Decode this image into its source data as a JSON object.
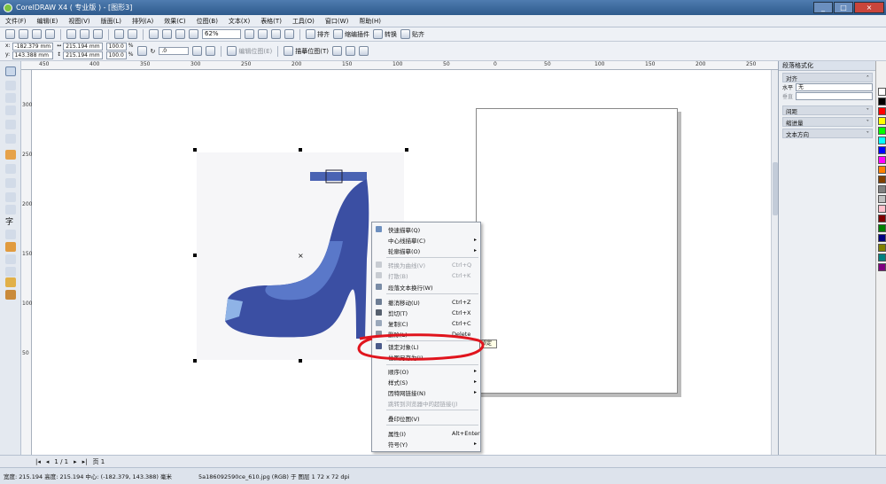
{
  "window": {
    "title": "CorelDRAW X4 ( 专业版 ) - [图形3]",
    "buttons": [
      "_",
      "□",
      "×"
    ]
  },
  "menubar": {
    "items": [
      "文件(F)",
      "编辑(E)",
      "视图(V)",
      "版面(L)",
      "排列(A)",
      "效果(C)",
      "位图(B)",
      "文本(X)",
      "表格(T)",
      "工具(O)",
      "窗口(W)",
      "帮助(H)"
    ]
  },
  "toolbar1": {
    "zoom": "62%",
    "buttons": [
      "排齐",
      "缩编插件",
      "转换",
      "贴齐"
    ]
  },
  "toolbar2": {
    "x": "-182.379 mm",
    "y": "143.388 mm",
    "w": "215.194 mm",
    "h": "215.194 mm",
    "scale_x": "100.0",
    "scale_y": "100.0",
    "pct": "%",
    "angle": ".0",
    "edit_bitmap": "编辑位图(E)",
    "trace_bitmap": "描摹位图(T)"
  },
  "ruler": {
    "top": [
      "450",
      "400",
      "350",
      "300",
      "250",
      "200",
      "150",
      "100",
      "50",
      "0",
      "50",
      "100",
      "150",
      "200",
      "250"
    ],
    "left": [
      "300",
      "250",
      "200",
      "150",
      "100",
      "50"
    ]
  },
  "docker": {
    "title": "段落格式化",
    "align_head": "对齐",
    "horizontal_label": "水平",
    "horizontal_value": "无",
    "vertical_label": "垂直",
    "spacing": "间距",
    "indent": "缩进量",
    "text_direction": "文本方向"
  },
  "context_menu": {
    "items": [
      {
        "label": "快速描摹(Q)",
        "shortcut": "",
        "arrow": "",
        "disabled": false,
        "icon": "trace-icon"
      },
      {
        "label": "中心线描摹(C)",
        "shortcut": "",
        "arrow": "▸",
        "disabled": false,
        "icon": ""
      },
      {
        "label": "轮廓描摹(O)",
        "shortcut": "",
        "arrow": "▸",
        "disabled": false,
        "icon": ""
      },
      {
        "label": "转换为曲线(V)",
        "shortcut": "Ctrl+Q",
        "arrow": "",
        "disabled": true,
        "icon": "curve-icon"
      },
      {
        "label": "打散(B)",
        "shortcut": "Ctrl+K",
        "arrow": "",
        "disabled": true,
        "icon": "break-icon"
      },
      {
        "label": "段落文本换行(W)",
        "shortcut": "",
        "arrow": "",
        "disabled": false,
        "icon": "wrap-icon"
      },
      {
        "label": "撤消移动(U)",
        "shortcut": "Ctrl+Z",
        "arrow": "",
        "disabled": false,
        "icon": "undo-icon"
      },
      {
        "label": "剪切(T)",
        "shortcut": "Ctrl+X",
        "arrow": "",
        "disabled": false,
        "icon": "cut-icon"
      },
      {
        "label": "复制(C)",
        "shortcut": "Ctrl+C",
        "arrow": "",
        "disabled": false,
        "icon": "copy-icon"
      },
      {
        "label": "删除(L)",
        "shortcut": "Delete",
        "arrow": "",
        "disabled": false,
        "icon": "delete-icon"
      },
      {
        "label": "锁定对象(L)",
        "shortcut": "",
        "arrow": "",
        "disabled": false,
        "icon": "lock-icon"
      },
      {
        "label": "位图另存为(I)...",
        "shortcut": "",
        "arrow": "",
        "disabled": false,
        "icon": ""
      },
      {
        "label": "顺序(O)",
        "shortcut": "",
        "arrow": "▸",
        "disabled": false,
        "icon": ""
      },
      {
        "label": "样式(S)",
        "shortcut": "",
        "arrow": "▸",
        "disabled": false,
        "icon": ""
      },
      {
        "label": "因特网链接(N)",
        "shortcut": "",
        "arrow": "▸",
        "disabled": false,
        "icon": ""
      },
      {
        "label": "跳转到浏览器中的超链接(J)",
        "shortcut": "",
        "arrow": "",
        "disabled": true,
        "icon": ""
      },
      {
        "label": "叠印位图(V)",
        "shortcut": "",
        "arrow": "",
        "disabled": false,
        "icon": ""
      },
      {
        "label": "属性(I)",
        "shortcut": "Alt+Enter",
        "arrow": "",
        "disabled": false,
        "icon": ""
      },
      {
        "label": "符号(Y)",
        "shortcut": "",
        "arrow": "▸",
        "disabled": false,
        "icon": ""
      }
    ],
    "tooltip": "锁定"
  },
  "pagenav": {
    "page_count": "1 / 1",
    "page_tab": "页 1"
  },
  "status": {
    "size": "宽度: 215.194  高度: 215.194  中心: (-182.379, 143.388)  毫米",
    "object": "5a186092590ce_610.jpg (RGB) 于 图层 1 72 x 72 dpi"
  },
  "colors": {
    "shoe_main": "#3b4fa3",
    "shoe_light": "#5a78c9",
    "annotation_red": "#e0141d"
  },
  "palette": [
    "#ffffff",
    "#000000",
    "#ff0000",
    "#ffff00",
    "#00ff00",
    "#00ffff",
    "#0000ff",
    "#ff00ff",
    "#ff8000",
    "#804000",
    "#808080",
    "#c0c0c0",
    "#ffc0cb",
    "#800000",
    "#008000",
    "#000080",
    "#808000",
    "#008080",
    "#800080"
  ]
}
